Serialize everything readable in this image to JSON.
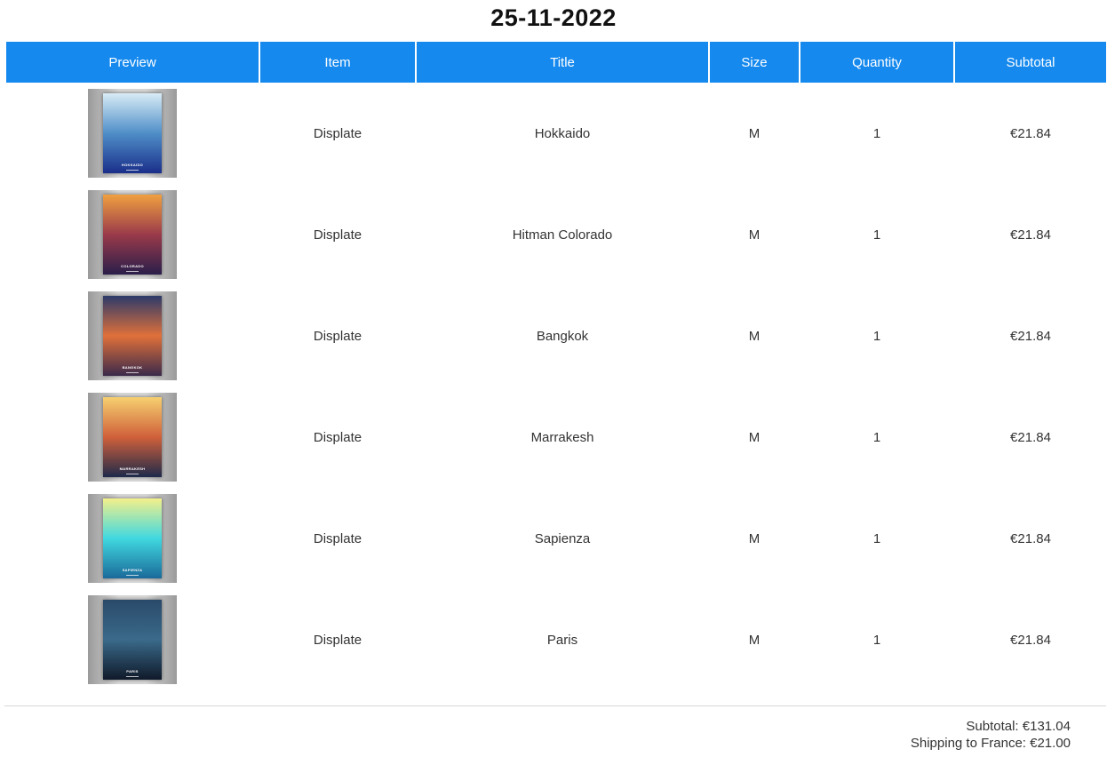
{
  "order": {
    "date": "25-11-2022"
  },
  "table": {
    "headers": [
      "Preview",
      "Item",
      "Title",
      "Size",
      "Quantity",
      "Subtotal"
    ],
    "rows": [
      {
        "item": "Displate",
        "title": "Hokkaido",
        "size": "M",
        "quantity": "1",
        "subtotal": "€21.84",
        "poster_label": "HOKKAIDO",
        "colors": [
          "#d8ecf6",
          "#4f8ec8",
          "#1a2f8a"
        ]
      },
      {
        "item": "Displate",
        "title": "Hitman Colorado",
        "size": "M",
        "quantity": "1",
        "subtotal": "€21.84",
        "poster_label": "COLORADO",
        "colors": [
          "#f0a040",
          "#9a3a4a",
          "#2a1e4a"
        ]
      },
      {
        "item": "Displate",
        "title": "Bangkok",
        "size": "M",
        "quantity": "1",
        "subtotal": "€21.84",
        "poster_label": "BANGKOK",
        "colors": [
          "#2c3a6a",
          "#e0703a",
          "#3a2a4a"
        ]
      },
      {
        "item": "Displate",
        "title": "Marrakesh",
        "size": "M",
        "quantity": "1",
        "subtotal": "€21.84",
        "poster_label": "MARRAKESH",
        "colors": [
          "#f6d070",
          "#d0603a",
          "#1e2a4a"
        ]
      },
      {
        "item": "Displate",
        "title": "Sapienza",
        "size": "M",
        "quantity": "1",
        "subtotal": "€21.84",
        "poster_label": "SAPIENZA",
        "colors": [
          "#f4f08a",
          "#40d8e0",
          "#1a6a9a"
        ]
      },
      {
        "item": "Displate",
        "title": "Paris",
        "size": "M",
        "quantity": "1",
        "subtotal": "€21.84",
        "poster_label": "PARIS",
        "colors": [
          "#2a4a6a",
          "#3a6a8a",
          "#101a2a"
        ]
      }
    ]
  },
  "summary": {
    "subtotal": "Subtotal: €131.04",
    "shipping": "Shipping to France: €21.00"
  },
  "colors": {
    "header_bg": "#1589ee",
    "header_text": "#ffffff",
    "divider": "#d7d7d7"
  }
}
